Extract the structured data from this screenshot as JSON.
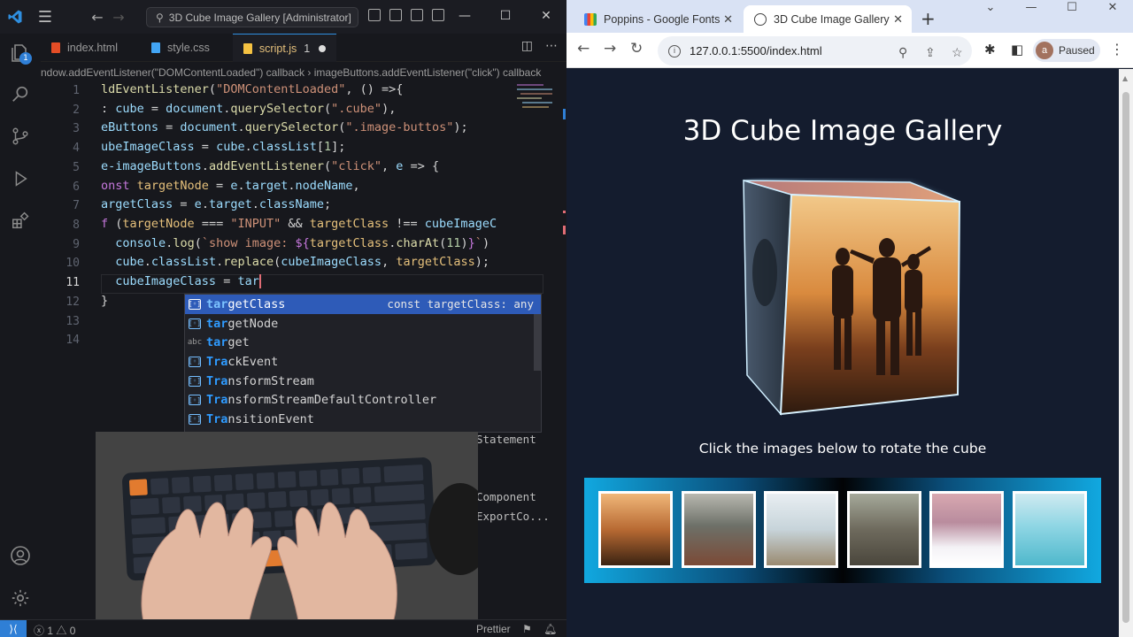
{
  "vscode": {
    "search": "3D Cube Image Gallery [Administrator]",
    "explorer_badge": "1",
    "tabs": [
      {
        "label": "index.html",
        "icon_color": "#e44d26"
      },
      {
        "label": "style.css",
        "icon_color": "#42a5f5"
      },
      {
        "label": "script.js",
        "icon_color": "#f5c242",
        "modified_count": "1"
      }
    ],
    "breadcrumb": {
      "left": "ndow.addEventListener(\"DOMContentLoaded\") callback",
      "sep": "›",
      "right": "imageButtons.addEventListener(\"click\") callback"
    },
    "line_numbers": [
      "1",
      "2",
      "3",
      "4",
      "5",
      "6",
      "7",
      "8",
      "9",
      "10",
      "11",
      "12",
      "13",
      "14"
    ],
    "current_line": "11",
    "suggestions": [
      {
        "match": "tar",
        "rest": "getClass",
        "kind": "var",
        "detail": "const targetClass: any"
      },
      {
        "match": "tar",
        "rest": "getNode",
        "kind": "var",
        "detail": ""
      },
      {
        "match": "tar",
        "rest": "get",
        "kind": "abc",
        "detail": ""
      },
      {
        "match": "Tra",
        "rest": "ckEvent",
        "kind": "var",
        "detail": ""
      },
      {
        "match": "Tra",
        "rest": "nsformStream",
        "kind": "var",
        "detail": ""
      },
      {
        "match": "Tra",
        "rest": "nsformStreamDefaultController",
        "kind": "var",
        "detail": ""
      },
      {
        "match": "Tra",
        "rest": "nsitionEvent",
        "kind": "var",
        "detail": ""
      }
    ],
    "behind_text": [
      "Statement",
      "Component",
      "ExportCo..."
    ],
    "status": {
      "errors": "1",
      "warnings": "0",
      "prettier": "Prettier"
    }
  },
  "chrome": {
    "tabs": [
      {
        "label": "Poppins - Google Fonts"
      },
      {
        "label": "3D Cube Image Gallery"
      }
    ],
    "url": "127.0.0.1:5500/index.html",
    "profile_initial": "a",
    "profile_status": "Paused"
  },
  "page": {
    "title": "3D Cube Image Gallery",
    "instructions": "Click the images below to rotate the cube",
    "thumbnails": [
      {
        "name": "friends-sunset"
      },
      {
        "name": "statue-couple"
      },
      {
        "name": "dog-pier"
      },
      {
        "name": "couple-rocks"
      },
      {
        "name": "snow-walk"
      },
      {
        "name": "lake-reflection"
      }
    ]
  },
  "colors": {
    "vscode_bg": "#17181d",
    "accent_blue": "#2f7fd6",
    "page_bg": "#141c2e",
    "suggest_selected": "#2e5bb8"
  }
}
